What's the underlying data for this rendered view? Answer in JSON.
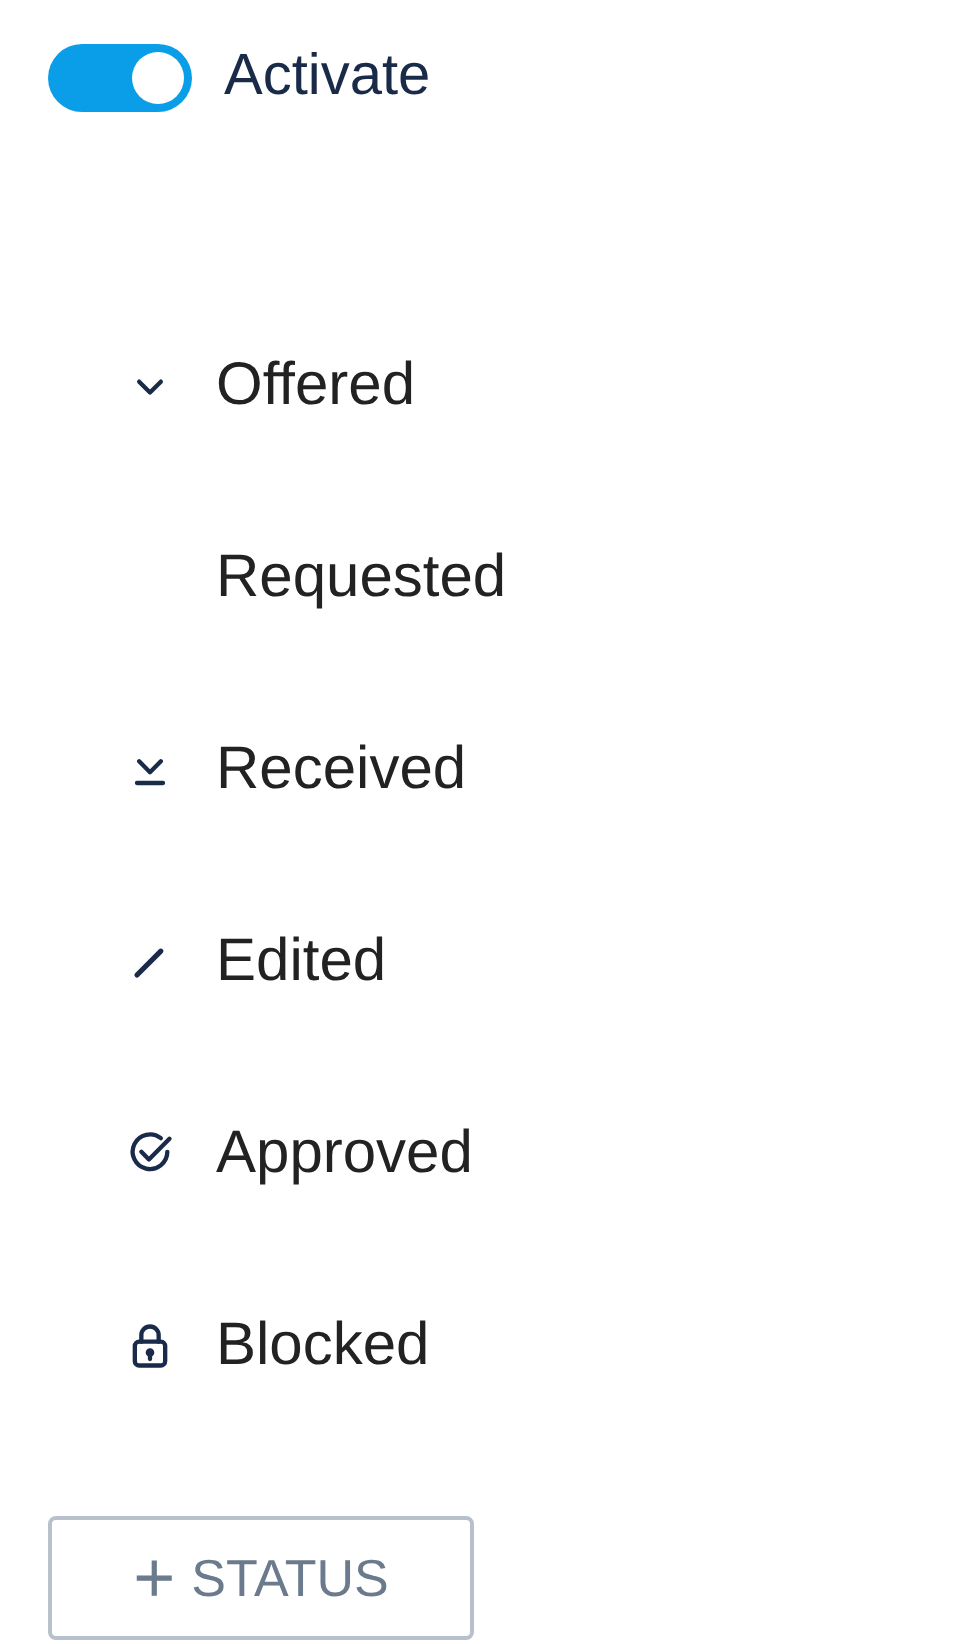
{
  "toggle": {
    "label": "Activate",
    "on": true
  },
  "statuses": [
    {
      "label": "Offered",
      "kind": "expand"
    },
    {
      "label": "Requested",
      "kind": "none"
    },
    {
      "label": "Received",
      "kind": "received"
    },
    {
      "label": "Edited",
      "kind": "edit"
    },
    {
      "label": "Approved",
      "kind": "approved"
    },
    {
      "label": "Blocked",
      "kind": "locked"
    }
  ],
  "add_button": {
    "icon": "+",
    "label": "STATUS"
  }
}
